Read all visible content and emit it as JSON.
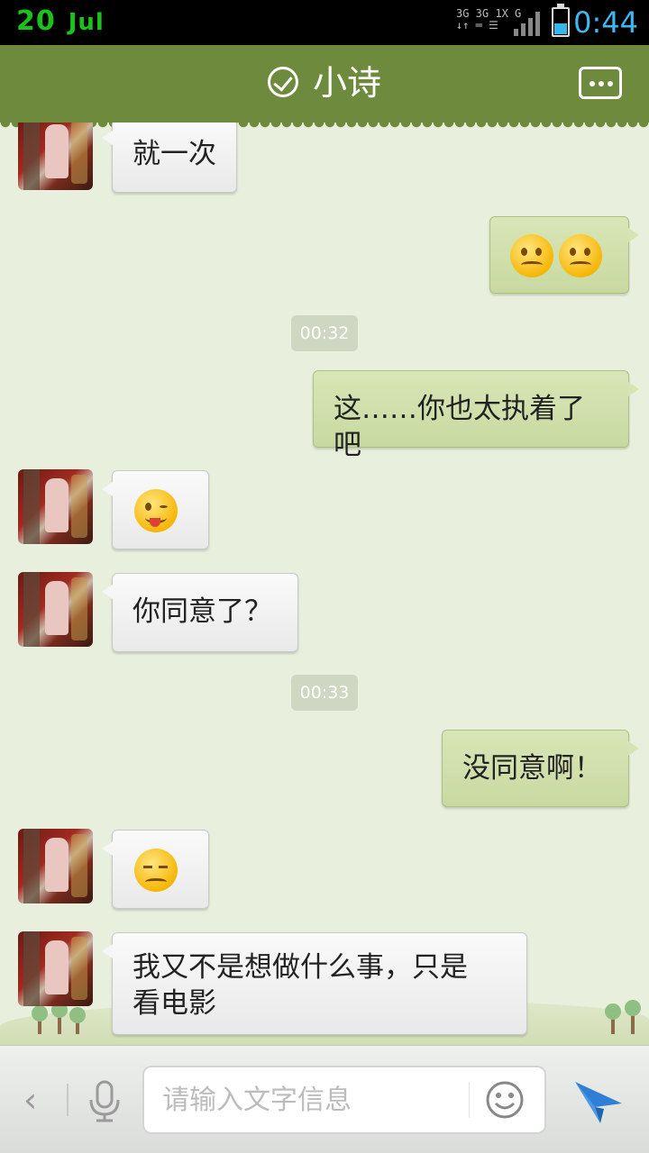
{
  "status_bar": {
    "date_day": "20",
    "date_month": "Jul",
    "network_top": "3G 3G 1X G",
    "time": "0:44"
  },
  "header": {
    "title": "小诗"
  },
  "timestamps": [
    "00:32",
    "00:33"
  ],
  "messages": [
    {
      "from": "contact",
      "text": "就一次"
    },
    {
      "from": "me",
      "emoji": [
        "awkward-face",
        "awkward-face"
      ]
    },
    {
      "from": "me",
      "text": "这……你也太执着了吧"
    },
    {
      "from": "contact",
      "emoji": [
        "tongue-wink-face"
      ]
    },
    {
      "from": "contact",
      "text": "你同意了？"
    },
    {
      "from": "me",
      "text": "没同意啊！"
    },
    {
      "from": "contact",
      "emoji": [
        "sad-face"
      ]
    },
    {
      "from": "contact",
      "text_line1": "我又不是想做什么事，只是",
      "text_line2": "看电影"
    }
  ],
  "input_bar": {
    "placeholder": "请输入文字信息"
  },
  "colors": {
    "header": "#6e8b3d",
    "background": "#e8efdc",
    "outgoing_bubble": "#cfdea8",
    "incoming_bubble": "#f2f2f2",
    "date_green": "#19c319",
    "time_blue": "#3fb8f0",
    "send_blue": "#2f7fd6"
  }
}
